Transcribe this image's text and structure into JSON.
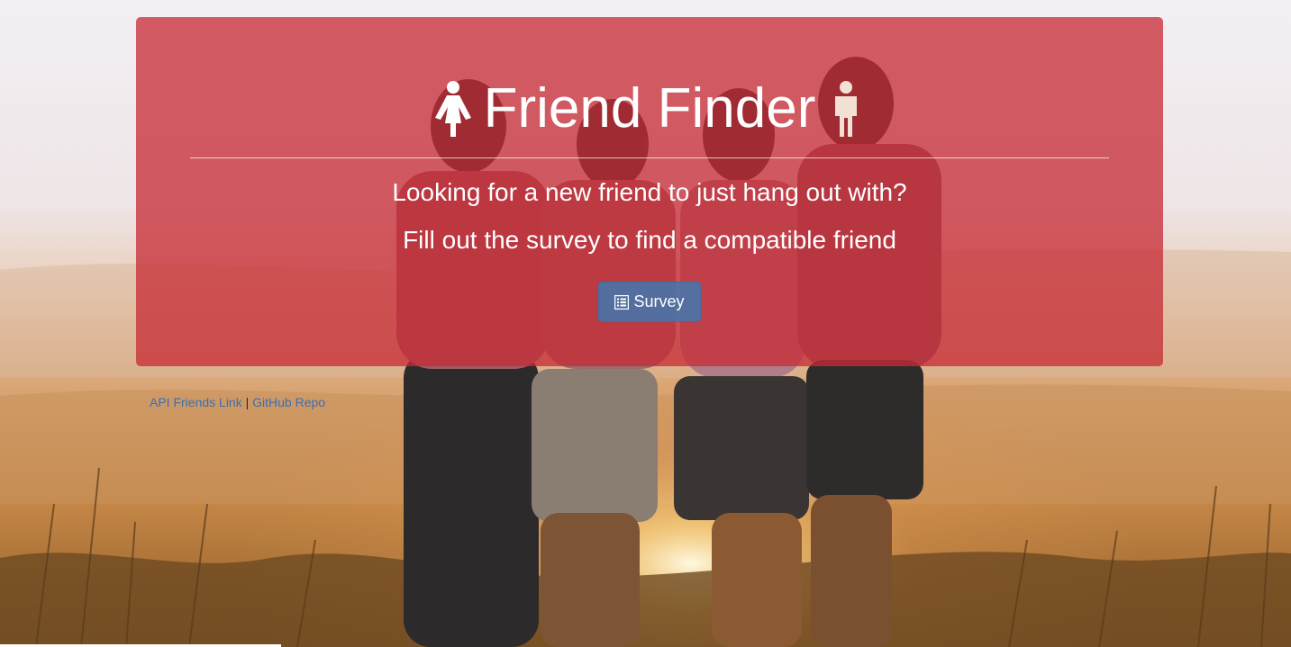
{
  "jumbotron": {
    "title": "Friend Finder",
    "female_icon": "female-icon",
    "male_icon": "male-icon",
    "lead_line_1": "Looking for a new friend to just hang out with?",
    "lead_line_2": "Fill out the survey to find a compatible friend",
    "survey_button": {
      "label": "Survey",
      "icon": "list-alt-icon"
    }
  },
  "footer": {
    "api_link": "API Friends Link",
    "separator": "|",
    "github_link": "GitHub Repo"
  },
  "colors": {
    "jumbotron_bg": "#c62c36",
    "button_bg": "#4178af",
    "link": "#3a6fb0",
    "title_text": "#ffffff"
  }
}
